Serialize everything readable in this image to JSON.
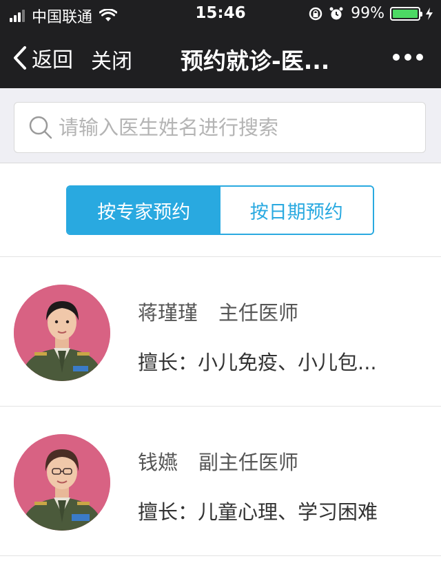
{
  "status": {
    "carrier": "中国联通",
    "time": "15:46",
    "battery": "99%",
    "battery_level": 0.99
  },
  "nav": {
    "back_label": "返回",
    "close_label": "关闭",
    "title": "预约就诊-医..."
  },
  "search": {
    "placeholder": "请输入医生姓名进行搜索"
  },
  "tabs": [
    {
      "label": "按专家预约",
      "active": true
    },
    {
      "label": "按日期预约",
      "active": false
    }
  ],
  "doctors": [
    {
      "name": "蒋瑾瑾",
      "title": "主任医师",
      "specialty": "擅长：小儿免疫、小儿包..."
    },
    {
      "name": "钱嬿",
      "title": "副主任医师",
      "specialty": "擅长：儿童心理、学习困难"
    }
  ],
  "colors": {
    "accent": "#29a9e0",
    "topbar": "#1f1f21",
    "battery": "#4cd964",
    "avatar_bg": "#d86283"
  }
}
